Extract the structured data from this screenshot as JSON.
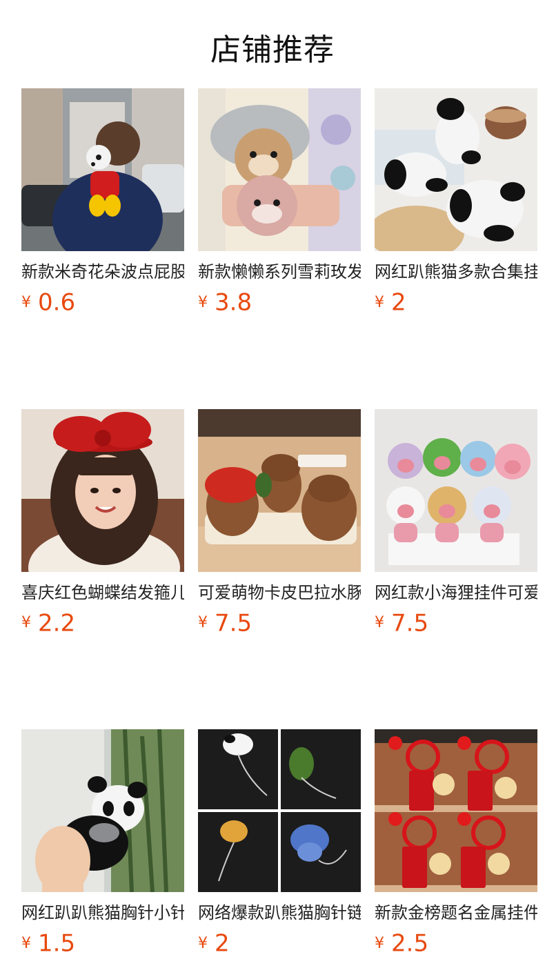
{
  "page": {
    "title": "店铺推荐"
  },
  "products": [
    {
      "name": "新款米奇花朵波点屁股",
      "currency": "¥",
      "price": "0.6",
      "image": "mickey-bow-hair-clip-photo"
    },
    {
      "name": "新款懒懒系列雪莉玫发夹",
      "currency": "¥",
      "price": "3.8",
      "image": "plush-bear-hair-clips-photo"
    },
    {
      "name": "网红趴熊猫多款合集挂件",
      "currency": "¥",
      "price": "2",
      "image": "panda-plush-collection-photo"
    },
    {
      "name": "喜庆红色蝴蝶结发箍儿童",
      "currency": "¥",
      "price": "2.2",
      "image": "red-bow-headband-photo"
    },
    {
      "name": "可爱萌物卡皮巴拉水豚摆件",
      "currency": "¥",
      "price": "7.5",
      "image": "capybara-plush-photo"
    },
    {
      "name": "网红款小海狸挂件可爱",
      "currency": "¥",
      "price": "7.5",
      "image": "beaver-plush-keychains-photo"
    },
    {
      "name": "网红趴趴熊猫胸针小针",
      "currency": "¥",
      "price": "1.5",
      "image": "panda-brooch-hand-photo"
    },
    {
      "name": "网络爆款趴熊猫胸针链",
      "currency": "¥",
      "price": "2",
      "image": "plush-brooch-collage-photo"
    },
    {
      "name": "新款金榜题名金属挂件",
      "currency": "¥",
      "price": "2.5",
      "image": "red-lion-keychains-photo"
    }
  ],
  "colors": {
    "price": "#e8490f",
    "text": "#222222",
    "background": "#ffffff"
  }
}
